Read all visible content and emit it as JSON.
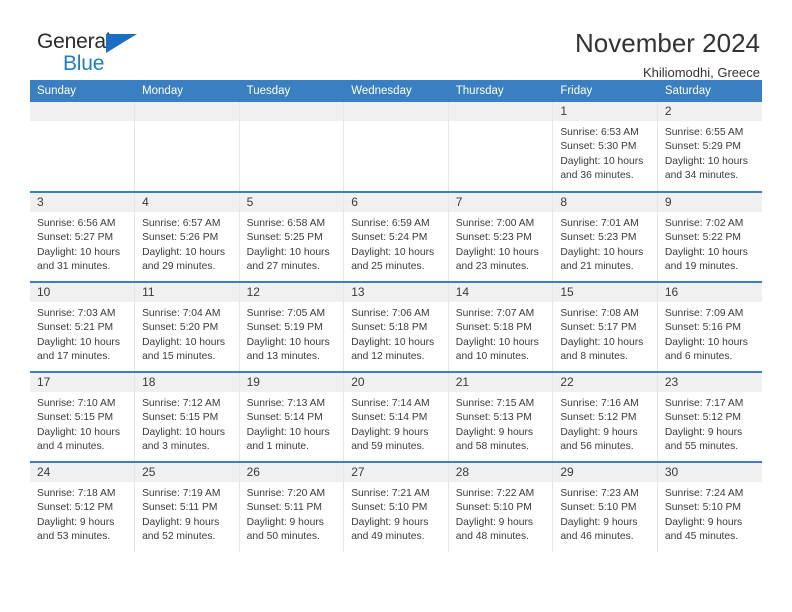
{
  "brand": {
    "name_part1": "General",
    "name_part2": "Blue",
    "logo_icon": "triangle-icon"
  },
  "header": {
    "month_title": "November 2024",
    "location": "Khiliomodhi, Greece"
  },
  "calendar": {
    "weekday_headers": [
      "Sunday",
      "Monday",
      "Tuesday",
      "Wednesday",
      "Thursday",
      "Friday",
      "Saturday"
    ],
    "accent_color": "#3a7fc1",
    "daynum_background": "#f0f0f0",
    "weeks": [
      [
        {
          "day": "",
          "lines": []
        },
        {
          "day": "",
          "lines": []
        },
        {
          "day": "",
          "lines": []
        },
        {
          "day": "",
          "lines": []
        },
        {
          "day": "",
          "lines": []
        },
        {
          "day": "1",
          "lines": [
            "Sunrise: 6:53 AM",
            "Sunset: 5:30 PM",
            "Daylight: 10 hours",
            "and 36 minutes."
          ]
        },
        {
          "day": "2",
          "lines": [
            "Sunrise: 6:55 AM",
            "Sunset: 5:29 PM",
            "Daylight: 10 hours",
            "and 34 minutes."
          ]
        }
      ],
      [
        {
          "day": "3",
          "lines": [
            "Sunrise: 6:56 AM",
            "Sunset: 5:27 PM",
            "Daylight: 10 hours",
            "and 31 minutes."
          ]
        },
        {
          "day": "4",
          "lines": [
            "Sunrise: 6:57 AM",
            "Sunset: 5:26 PM",
            "Daylight: 10 hours",
            "and 29 minutes."
          ]
        },
        {
          "day": "5",
          "lines": [
            "Sunrise: 6:58 AM",
            "Sunset: 5:25 PM",
            "Daylight: 10 hours",
            "and 27 minutes."
          ]
        },
        {
          "day": "6",
          "lines": [
            "Sunrise: 6:59 AM",
            "Sunset: 5:24 PM",
            "Daylight: 10 hours",
            "and 25 minutes."
          ]
        },
        {
          "day": "7",
          "lines": [
            "Sunrise: 7:00 AM",
            "Sunset: 5:23 PM",
            "Daylight: 10 hours",
            "and 23 minutes."
          ]
        },
        {
          "day": "8",
          "lines": [
            "Sunrise: 7:01 AM",
            "Sunset: 5:23 PM",
            "Daylight: 10 hours",
            "and 21 minutes."
          ]
        },
        {
          "day": "9",
          "lines": [
            "Sunrise: 7:02 AM",
            "Sunset: 5:22 PM",
            "Daylight: 10 hours",
            "and 19 minutes."
          ]
        }
      ],
      [
        {
          "day": "10",
          "lines": [
            "Sunrise: 7:03 AM",
            "Sunset: 5:21 PM",
            "Daylight: 10 hours",
            "and 17 minutes."
          ]
        },
        {
          "day": "11",
          "lines": [
            "Sunrise: 7:04 AM",
            "Sunset: 5:20 PM",
            "Daylight: 10 hours",
            "and 15 minutes."
          ]
        },
        {
          "day": "12",
          "lines": [
            "Sunrise: 7:05 AM",
            "Sunset: 5:19 PM",
            "Daylight: 10 hours",
            "and 13 minutes."
          ]
        },
        {
          "day": "13",
          "lines": [
            "Sunrise: 7:06 AM",
            "Sunset: 5:18 PM",
            "Daylight: 10 hours",
            "and 12 minutes."
          ]
        },
        {
          "day": "14",
          "lines": [
            "Sunrise: 7:07 AM",
            "Sunset: 5:18 PM",
            "Daylight: 10 hours",
            "and 10 minutes."
          ]
        },
        {
          "day": "15",
          "lines": [
            "Sunrise: 7:08 AM",
            "Sunset: 5:17 PM",
            "Daylight: 10 hours",
            "and 8 minutes."
          ]
        },
        {
          "day": "16",
          "lines": [
            "Sunrise: 7:09 AM",
            "Sunset: 5:16 PM",
            "Daylight: 10 hours",
            "and 6 minutes."
          ]
        }
      ],
      [
        {
          "day": "17",
          "lines": [
            "Sunrise: 7:10 AM",
            "Sunset: 5:15 PM",
            "Daylight: 10 hours",
            "and 4 minutes."
          ]
        },
        {
          "day": "18",
          "lines": [
            "Sunrise: 7:12 AM",
            "Sunset: 5:15 PM",
            "Daylight: 10 hours",
            "and 3 minutes."
          ]
        },
        {
          "day": "19",
          "lines": [
            "Sunrise: 7:13 AM",
            "Sunset: 5:14 PM",
            "Daylight: 10 hours",
            "and 1 minute."
          ]
        },
        {
          "day": "20",
          "lines": [
            "Sunrise: 7:14 AM",
            "Sunset: 5:14 PM",
            "Daylight: 9 hours",
            "and 59 minutes."
          ]
        },
        {
          "day": "21",
          "lines": [
            "Sunrise: 7:15 AM",
            "Sunset: 5:13 PM",
            "Daylight: 9 hours",
            "and 58 minutes."
          ]
        },
        {
          "day": "22",
          "lines": [
            "Sunrise: 7:16 AM",
            "Sunset: 5:12 PM",
            "Daylight: 9 hours",
            "and 56 minutes."
          ]
        },
        {
          "day": "23",
          "lines": [
            "Sunrise: 7:17 AM",
            "Sunset: 5:12 PM",
            "Daylight: 9 hours",
            "and 55 minutes."
          ]
        }
      ],
      [
        {
          "day": "24",
          "lines": [
            "Sunrise: 7:18 AM",
            "Sunset: 5:12 PM",
            "Daylight: 9 hours",
            "and 53 minutes."
          ]
        },
        {
          "day": "25",
          "lines": [
            "Sunrise: 7:19 AM",
            "Sunset: 5:11 PM",
            "Daylight: 9 hours",
            "and 52 minutes."
          ]
        },
        {
          "day": "26",
          "lines": [
            "Sunrise: 7:20 AM",
            "Sunset: 5:11 PM",
            "Daylight: 9 hours",
            "and 50 minutes."
          ]
        },
        {
          "day": "27",
          "lines": [
            "Sunrise: 7:21 AM",
            "Sunset: 5:10 PM",
            "Daylight: 9 hours",
            "and 49 minutes."
          ]
        },
        {
          "day": "28",
          "lines": [
            "Sunrise: 7:22 AM",
            "Sunset: 5:10 PM",
            "Daylight: 9 hours",
            "and 48 minutes."
          ]
        },
        {
          "day": "29",
          "lines": [
            "Sunrise: 7:23 AM",
            "Sunset: 5:10 PM",
            "Daylight: 9 hours",
            "and 46 minutes."
          ]
        },
        {
          "day": "30",
          "lines": [
            "Sunrise: 7:24 AM",
            "Sunset: 5:10 PM",
            "Daylight: 9 hours",
            "and 45 minutes."
          ]
        }
      ]
    ]
  }
}
